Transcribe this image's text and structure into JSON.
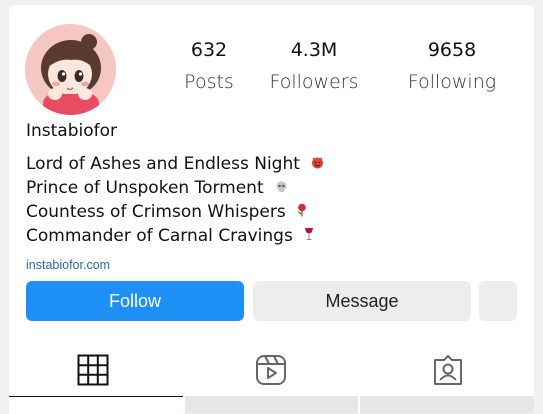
{
  "profile": {
    "username": "Instabiofor",
    "link": "instabiofor.com"
  },
  "stats": [
    {
      "value": "632",
      "label": "Posts"
    },
    {
      "value": "4.3M",
      "label": "Followers"
    },
    {
      "value": "9658",
      "label": "Following"
    }
  ],
  "bio": [
    {
      "text": "Lord of Ashes and Endless Night",
      "emoji": "devil-face-icon"
    },
    {
      "text": "Prince of Unspoken Torment",
      "emoji": "skull-icon"
    },
    {
      "text": "Countess of Crimson Whispers",
      "emoji": "rose-icon"
    },
    {
      "text": "Commander of Carnal Cravings",
      "emoji": "wine-glass-icon"
    }
  ],
  "buttons": {
    "follow_label": "Follow",
    "message_label": "Message"
  },
  "tabs": [
    {
      "icon": "grid-icon",
      "active": true
    },
    {
      "icon": "reels-icon",
      "active": false
    },
    {
      "icon": "tagged-icon",
      "active": false
    }
  ],
  "colors": {
    "follow_button": "#1e90f5",
    "secondary_button": "#ededed",
    "link": "#2b6aa8"
  }
}
